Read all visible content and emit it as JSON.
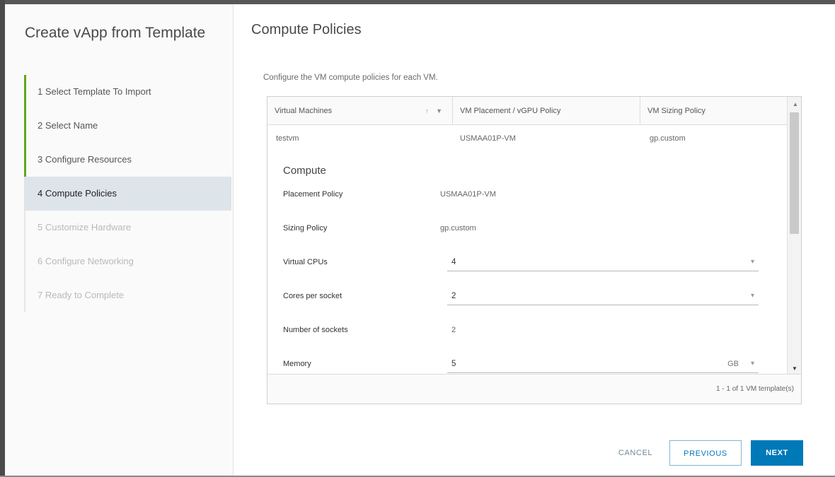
{
  "wizard": {
    "title": "Create vApp from Template",
    "steps": [
      {
        "label": "1  Select Template To Import",
        "state": "done"
      },
      {
        "label": "2  Select Name",
        "state": "done"
      },
      {
        "label": "3  Configure Resources",
        "state": "done"
      },
      {
        "label": "4  Compute Policies",
        "state": "current"
      },
      {
        "label": "5  Customize Hardware",
        "state": "disabled"
      },
      {
        "label": "6  Configure Networking",
        "state": "disabled"
      },
      {
        "label": "7  Ready to Complete",
        "state": "disabled"
      }
    ]
  },
  "page": {
    "title": "Compute Policies",
    "description": "Configure the VM compute policies for each VM."
  },
  "grid": {
    "columns": [
      "Virtual Machines",
      "VM Placement / vGPU Policy",
      "VM Sizing Policy"
    ],
    "sort_icons": "↑ ▼",
    "row": {
      "vm": "testvm",
      "placement": "USMAA01P-VM",
      "sizing": "gp.custom"
    },
    "footer": "1 - 1 of 1 VM template(s)"
  },
  "compute": {
    "heading": "Compute",
    "placement_label": "Placement Policy",
    "placement_value": "USMAA01P-VM",
    "sizing_label": "Sizing Policy",
    "sizing_value": "gp.custom",
    "vcpu_label": "Virtual CPUs",
    "vcpu_value": "4",
    "cores_label": "Cores per socket",
    "cores_value": "2",
    "sockets_label": "Number of sockets",
    "sockets_value": "2",
    "memory_label": "Memory",
    "memory_value": "5",
    "memory_unit": "GB"
  },
  "buttons": {
    "cancel": "CANCEL",
    "previous": "PREVIOUS",
    "next": "NEXT"
  },
  "colors": {
    "accent": "#0079b8",
    "done_step_bar": "#62a420",
    "current_step_bg": "#dde4ea"
  }
}
